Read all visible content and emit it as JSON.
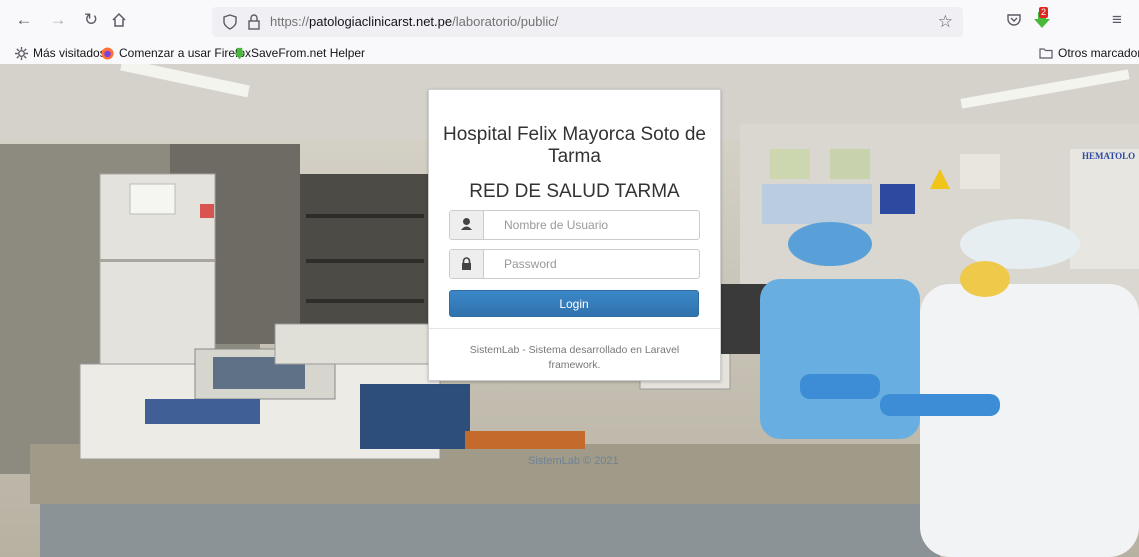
{
  "browser": {
    "url_prefix": "https://",
    "url_domain": "patologiaclinicarst.net.pe",
    "url_path": "/laboratorio/public/",
    "notification_count": "2"
  },
  "bookmarks": {
    "items": [
      "Más visitados",
      "Comenzar a usar Firefox",
      "SaveFrom.net Helper"
    ],
    "other": "Otros marcadores"
  },
  "login": {
    "title": "Hospital Felix Mayorca Soto de Tarma",
    "subtitle": "RED DE SALUD TARMA",
    "username_placeholder": "Nombre de Usuario",
    "password_placeholder": "Password",
    "login_label": "Login",
    "footer": "SistemLab - Sistema desarrollado en Laravel framework."
  },
  "background": {
    "wall_sign": "HEMATOLO",
    "copyright": "SistemLab © 2021"
  }
}
